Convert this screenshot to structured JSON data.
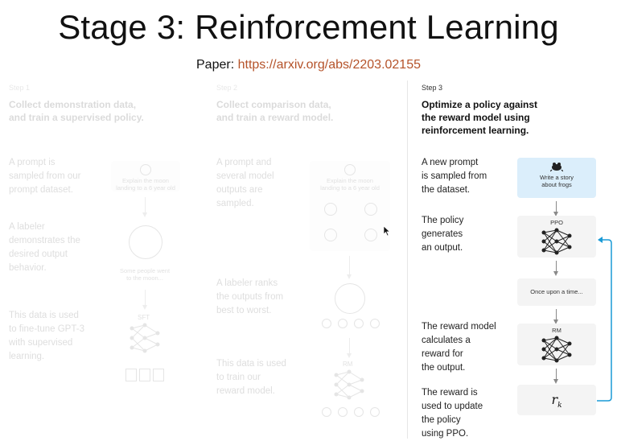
{
  "title": "Stage 3: Reinforcement Learning",
  "paper": {
    "label": "Paper:",
    "url": "https://arxiv.org/abs/2203.02155"
  },
  "step1": {
    "num": "Step 1",
    "heading_l1": "Collect demonstration data,",
    "heading_l2": "and train a supervised policy.",
    "d1": [
      "A prompt is",
      "sampled from our",
      "prompt dataset."
    ],
    "d2": [
      "A labeler",
      "demonstrates the",
      "desired output",
      "behavior."
    ],
    "d3": [
      "This data is used",
      "to fine-tune GPT-3",
      "with supervised",
      "learning."
    ],
    "box1_l1": "Explain the moon",
    "box1_l2": "landing to a 6 year old",
    "labeler_l1": "Some people went",
    "labeler_l2": "to the moon...",
    "model": "SFT"
  },
  "step2": {
    "num": "Step 2",
    "heading_l1": "Collect comparison data,",
    "heading_l2": "and train a reward model.",
    "d1": [
      "A prompt and",
      "several model",
      "outputs are",
      "sampled."
    ],
    "d2": [
      "A labeler ranks",
      "the outputs from",
      "best to worst."
    ],
    "d3": [
      "This data is used",
      "to train our",
      "reward model."
    ],
    "box1_l1": "Explain the moon",
    "box1_l2": "landing to a 6 year old",
    "options": [
      "A",
      "B",
      "C",
      "D"
    ],
    "rank": [
      "D",
      "C",
      "A",
      "B"
    ],
    "model": "RM"
  },
  "step3": {
    "num": "Step 3",
    "heading": [
      "Optimize a policy against",
      "the reward model using",
      "reinforcement learning."
    ],
    "d1": [
      "A new prompt",
      "is sampled from",
      "the dataset."
    ],
    "d2": [
      "The policy",
      "generates",
      "an output."
    ],
    "d3": [
      "The reward model",
      "calculates a",
      "reward for",
      "the output."
    ],
    "d4": [
      "The reward is",
      "used to update",
      "the policy",
      "using PPO."
    ],
    "prompt_l1": "Write a story",
    "prompt_l2": "about frogs",
    "ppo": "PPO",
    "output": "Once upon a time...",
    "rm": "RM",
    "reward_symbol": "r",
    "reward_sub": "k"
  },
  "colors": {
    "link": "#b5532a",
    "prompt_box": "#dbeefb",
    "feedback_arrow": "#1a9ad6"
  }
}
